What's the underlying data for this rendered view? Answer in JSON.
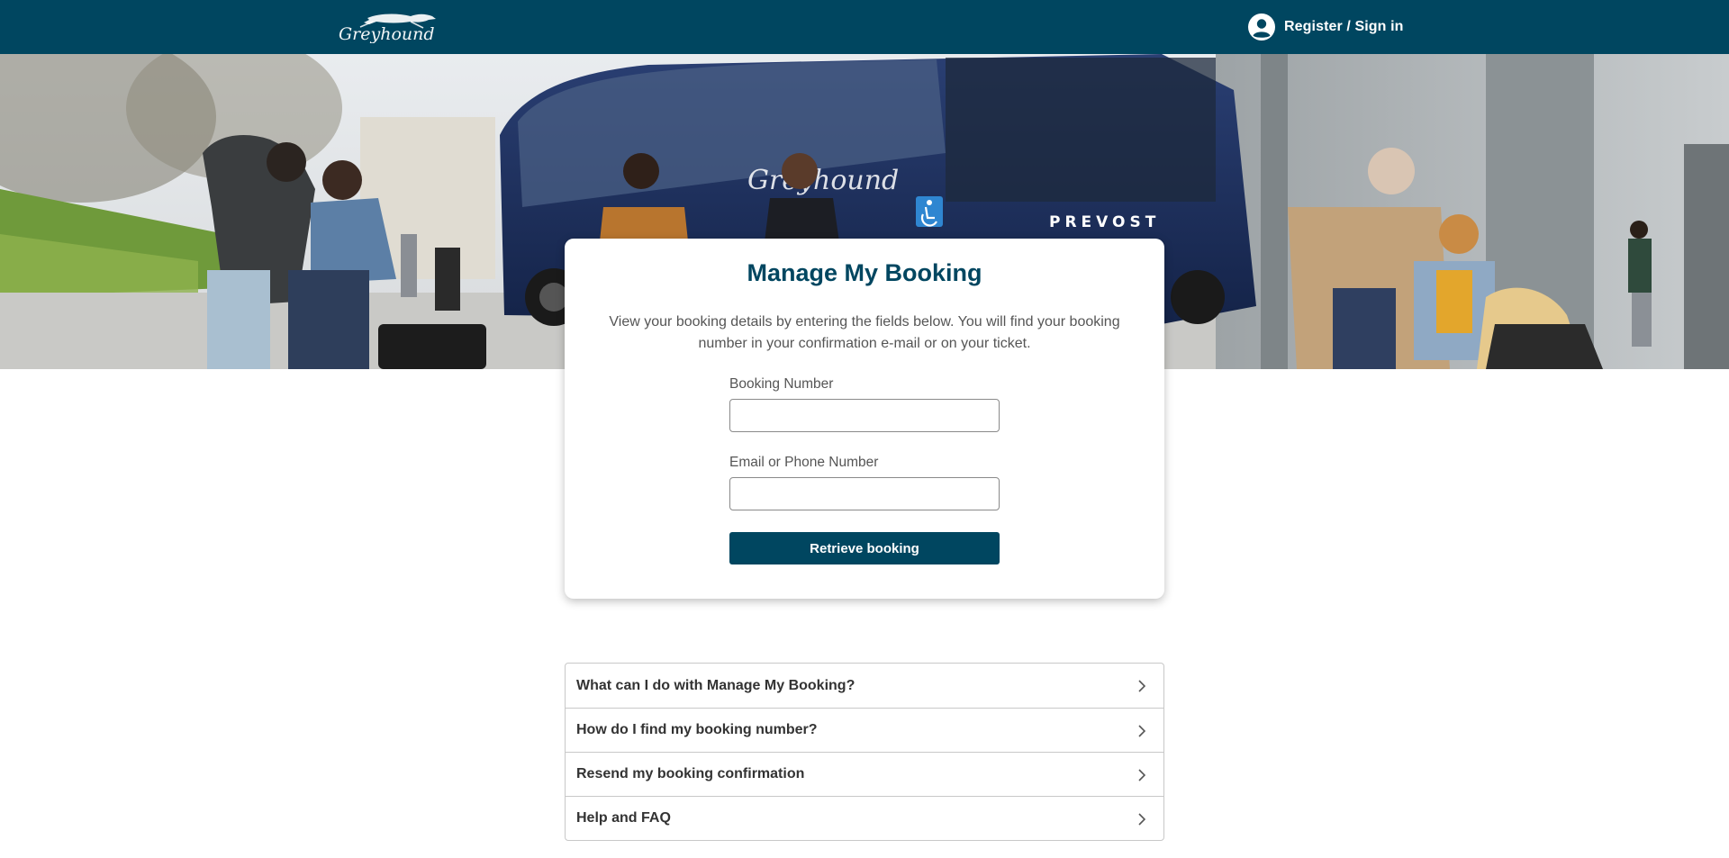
{
  "header": {
    "logo_text": "Greyhound",
    "signin_label": "Register / Sign in"
  },
  "hero": {
    "bus_text": "PREVOST",
    "bus_brand": "Greyhound"
  },
  "card": {
    "title": "Manage My Booking",
    "description": "View your booking details by entering the fields below. You will find your booking number in your confirmation e-mail or on your ticket.",
    "booking_number_label": "Booking Number",
    "booking_number_value": "",
    "contact_label": "Email or Phone Number",
    "contact_value": "",
    "submit_label": "Retrieve booking"
  },
  "faq": {
    "items": [
      {
        "label": "What can I do with Manage My Booking?"
      },
      {
        "label": "How do I find my booking number?"
      },
      {
        "label": "Resend my booking confirmation"
      },
      {
        "label": "Help and FAQ"
      }
    ]
  },
  "colors": {
    "brand": "#004660",
    "text": "#333333"
  },
  "icons": {
    "user": "user-circle-icon",
    "chevron": "chevron-right-icon"
  }
}
